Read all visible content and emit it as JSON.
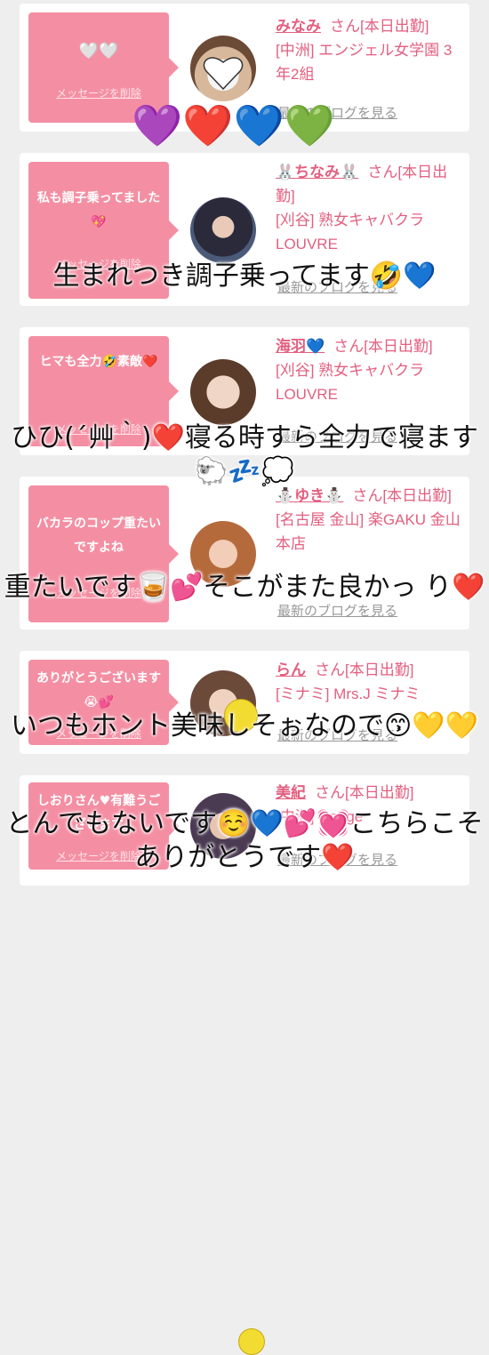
{
  "posts": [
    {
      "message": "🤍🤍",
      "delete_label": "メッセージを削除",
      "name": "みなみ",
      "name_suffix": "さん[本日出勤]",
      "shop": "[中洲] エンジェル女学園 3年2組",
      "blog_link": "最新のブログを見る",
      "overlay": "💜❤️💙💚"
    },
    {
      "message": "私も調子乗ってました💖",
      "delete_label": "メッセージを削除",
      "name": "🐰ちなみ🐰",
      "name_suffix": "さん[本日出勤]",
      "shop": "[刈谷] 熟女キャバクラ LOUVRE",
      "blog_link": "最新のブログを見る",
      "overlay": "生まれつき調子乗ってます🤣💙"
    },
    {
      "message": "ヒマも全力🤣素敵❤️",
      "delete_label": "メッセージを削除",
      "name": "海羽💙",
      "name_suffix": "さん[本日出勤]",
      "shop": "[刈谷] 熟女キャバクラ LOUVRE",
      "blog_link": "最新のブログを見る",
      "overlay": "ひひ(´艸｀)❤️寝る時すら全力で寝ます🐑💤💭"
    },
    {
      "message": "バカラのコップ重たいですよね",
      "delete_label": "メッセージを削除",
      "name": "⛄ゆき⛄",
      "name_suffix": "さん[本日出勤]",
      "shop": "[名古屋 金山] 楽GAKU 金山本店",
      "blog_link": "最新のブログを見る",
      "overlay": "重たいです🥃💕そこがまた良かっ り❤️"
    },
    {
      "message": "ありがとうございます😭💕",
      "delete_label": "メッセージを削除",
      "name": "らん",
      "name_suffix": "さん[本日出勤]",
      "shop": "[ミナミ] Mrs.J ミナミ",
      "blog_link": "最新のブログを見る",
      "overlay": "いつもホント美味しそぉなので😙💛💛"
    },
    {
      "message": "しおりさん♥有難うございます",
      "delete_label": "メッセージを削除",
      "name": "美紀",
      "name_suffix": "さん[本日出勤]",
      "shop": "[中洲] Rouge",
      "blog_link": "最新のブログを見る",
      "overlay": "とんでもないです☺️💙💕💓こちらこそありがとうです❤️"
    }
  ],
  "colors": {
    "accent": "#e35f7f",
    "bubble": "#f48fa3",
    "background": "#eeeeee"
  }
}
